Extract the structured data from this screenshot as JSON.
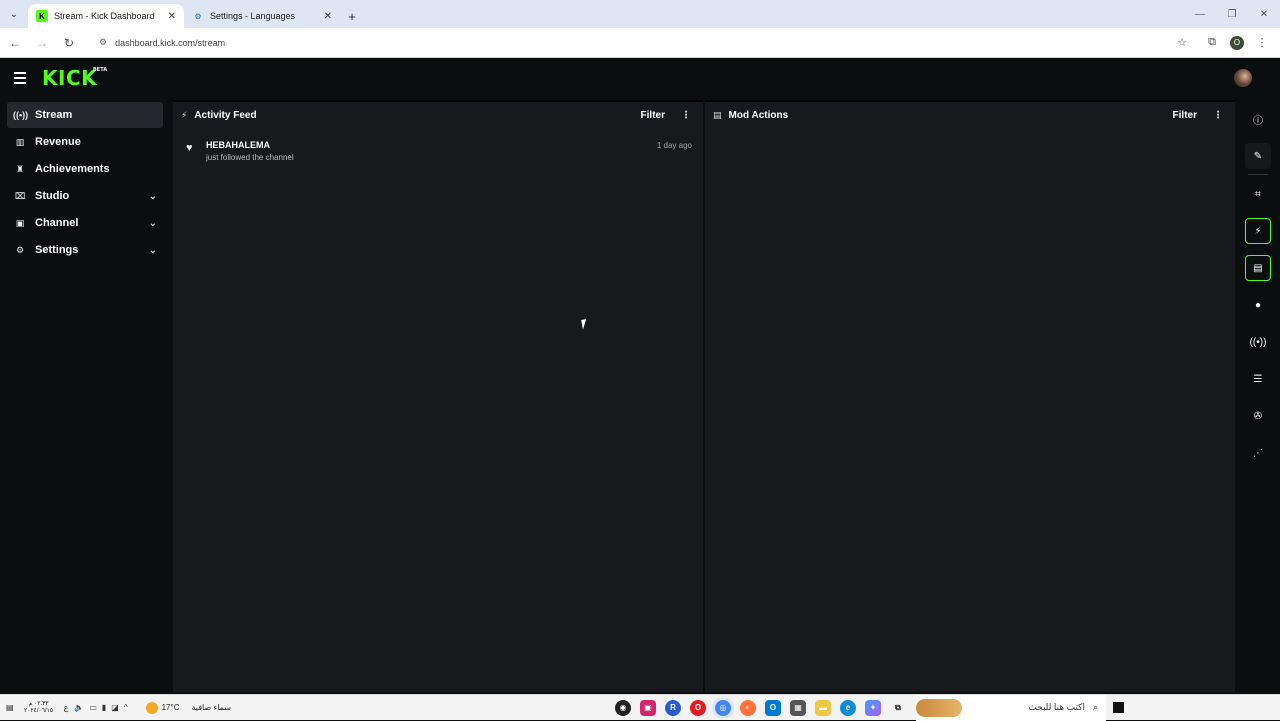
{
  "browser": {
    "tabs": [
      {
        "title": "Stream - Kick Dashboard",
        "active": true,
        "favicon": "kick-icon"
      },
      {
        "title": "Settings - Languages",
        "active": false,
        "favicon": "gear-icon"
      }
    ],
    "url": "dashboard.kick.com/stream",
    "profile_initial": "O"
  },
  "app": {
    "logo": "KICK",
    "logo_badge": "BETA",
    "accent": "#53fc18",
    "sidebar": {
      "items": [
        {
          "label": "Stream",
          "icon": "stream-icon",
          "active": true,
          "expandable": false
        },
        {
          "label": "Revenue",
          "icon": "chart-icon",
          "active": false,
          "expandable": false
        },
        {
          "label": "Achievements",
          "icon": "trophy-icon",
          "active": false,
          "expandable": false
        },
        {
          "label": "Studio",
          "icon": "studio-icon",
          "active": false,
          "expandable": true
        },
        {
          "label": "Channel",
          "icon": "channel-icon",
          "active": false,
          "expandable": true
        },
        {
          "label": "Settings",
          "icon": "gear-icon",
          "active": false,
          "expandable": true
        }
      ]
    },
    "activity_feed": {
      "title": "Activity Feed",
      "filter_label": "Filter",
      "items": [
        {
          "user": "HEBAHALEMA",
          "action": "just followed the channel",
          "time": "1 day ago",
          "icon": "heart-icon"
        }
      ]
    },
    "mod_actions": {
      "title": "Mod Actions",
      "filter_label": "Filter"
    },
    "right_toolbar": [
      "info-icon",
      "pencil-icon",
      "focus-icon",
      "lightning-icon",
      "mod-log-icon",
      "chat-icon",
      "broadcast-icon",
      "layout-icon",
      "wrench-icon",
      "share-icon"
    ]
  },
  "taskbar": {
    "clock_time": "٠٢:٣٣ م",
    "clock_date": "٢٠٢٤/٠٦/١٥",
    "lang": "ع",
    "weather_temp": "17°C",
    "weather_text": "سماء صافية",
    "search_placeholder": "اكتب هنا للبحث"
  }
}
